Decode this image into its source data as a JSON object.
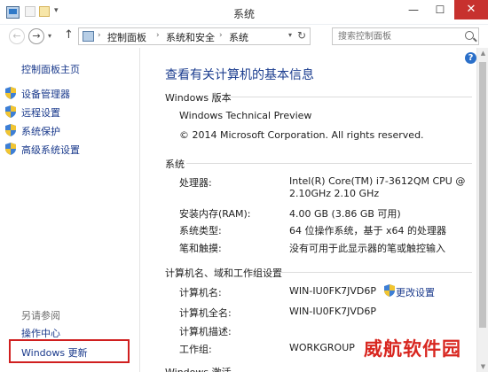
{
  "window": {
    "title": "系统",
    "min_glyph": "—",
    "max_glyph": "☐",
    "close_glyph": "✕"
  },
  "nav": {
    "back_glyph": "←",
    "forward_glyph": "→",
    "up_glyph": "↑",
    "breadcrumbs": [
      "控制面板",
      "系统和安全",
      "系统"
    ],
    "crumb_separator": "›",
    "search_placeholder": "搜索控制面板"
  },
  "sidebar": {
    "home": "控制面板主页",
    "items": [
      {
        "label": "设备管理器",
        "icon": "uac-shield-icon"
      },
      {
        "label": "远程设置",
        "icon": "uac-shield-icon"
      },
      {
        "label": "系统保护",
        "icon": "uac-shield-icon"
      },
      {
        "label": "高级系统设置",
        "icon": "uac-shield-icon"
      }
    ],
    "see_also": "另请参阅",
    "links": [
      "操作中心",
      "Windows 更新"
    ]
  },
  "main": {
    "title": "查看有关计算机的基本信息",
    "edition": {
      "header": "Windows 版本",
      "name": "Windows Technical Preview",
      "copyright": "© 2014 Microsoft Corporation. All rights reserved."
    },
    "system": {
      "header": "系统",
      "rows": [
        {
          "label": "处理器:",
          "value": "Intel(R) Core(TM) i7-3612QM CPU @",
          "value2": "2.10GHz   2.10 GHz"
        },
        {
          "label": "安装内存(RAM):",
          "value": "4.00 GB (3.86 GB 可用)"
        },
        {
          "label": "系统类型:",
          "value": "64 位操作系统，基于 x64 的处理器"
        },
        {
          "label": "笔和触摸:",
          "value": "没有可用于此显示器的笔或触控输入"
        }
      ]
    },
    "computer": {
      "header": "计算机名、域和工作组设置",
      "rows": [
        {
          "label": "计算机名:",
          "value": "WIN-IU0FK7JVD6P"
        },
        {
          "label": "计算机全名:",
          "value": "WIN-IU0FK7JVD6P"
        },
        {
          "label": "计算机描述:",
          "value": ""
        },
        {
          "label": "工作组:",
          "value": "WORKGROUP"
        }
      ],
      "change_link": "更改设置"
    },
    "next_header_partial": "Windows 激活"
  },
  "watermark": "威航软件园",
  "colors": {
    "link": "#1a3a8c",
    "title_blue": "#1b3d8f",
    "close_red": "#c7312e",
    "highlight_red": "#d01f1f"
  }
}
